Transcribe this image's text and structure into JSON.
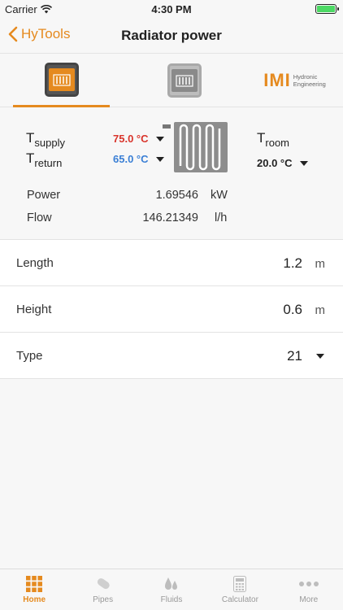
{
  "status_bar": {
    "carrier": "Carrier",
    "time": "4:30 PM"
  },
  "nav": {
    "back_label": "HyTools",
    "title": "Radiator power"
  },
  "brand": {
    "mark": "IMI",
    "line1": "Hydronic",
    "line2": "Engineering"
  },
  "temperatures": {
    "supply": {
      "symbol": "T",
      "subscript": "supply",
      "value": "75.0 °C",
      "color": "#d9342b"
    },
    "return": {
      "symbol": "T",
      "subscript": "return",
      "value": "65.0 °C",
      "color": "#3a7fd5"
    },
    "room": {
      "symbol": "T",
      "subscript": "room",
      "value": "20.0 °C"
    }
  },
  "results": {
    "power": {
      "label": "Power",
      "value": "1.69546",
      "unit": "kW"
    },
    "flow": {
      "label": "Flow",
      "value": "146.21349",
      "unit": "l/h"
    }
  },
  "inputs": {
    "length": {
      "label": "Length",
      "value": "1.2",
      "unit": "m"
    },
    "height": {
      "label": "Height",
      "value": "0.6",
      "unit": "m"
    },
    "type": {
      "label": "Type",
      "value": "21"
    }
  },
  "tabbar": {
    "home": "Home",
    "pipes": "Pipes",
    "fluids": "Fluids",
    "calculator": "Calculator",
    "more": "More"
  },
  "colors": {
    "accent": "#e58a1f",
    "battery": "#4cd964"
  }
}
